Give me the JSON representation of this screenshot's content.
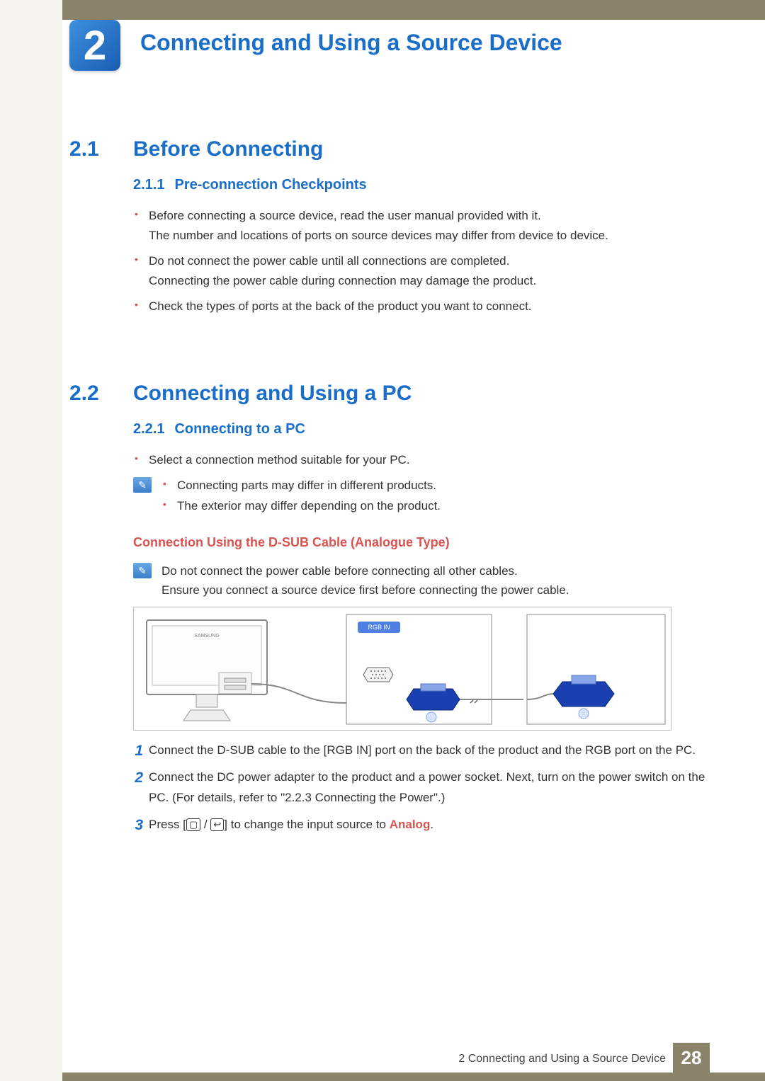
{
  "chapter": {
    "number": "2",
    "title": "Connecting and Using a Source Device"
  },
  "sections": {
    "s21": {
      "num": "2.1",
      "title": "Before Connecting"
    },
    "s211": {
      "num": "2.1.1",
      "title": "Pre-connection Checkpoints"
    },
    "s22": {
      "num": "2.2",
      "title": "Connecting and Using a PC"
    },
    "s221": {
      "num": "2.2.1",
      "title": "Connecting to a PC"
    }
  },
  "bullets211": [
    "Before connecting a source device, read the user manual provided with it.\nThe number and locations of ports on source devices may differ from device to device.",
    "Do not connect the power cable until all connections are completed.\nConnecting the power cable during connection may damage the product.",
    "Check the types of ports at the back of the product you want to connect."
  ],
  "bullets221": [
    "Select a connection method suitable for your PC."
  ],
  "note221": [
    "Connecting parts may differ in different products.",
    "The exterior may differ depending on the product."
  ],
  "h3_dsub": "Connection Using the D-SUB Cable (Analogue Type)",
  "note_dsub": "Do not connect the power cable before connecting all other cables.\nEnsure you connect a source device first before connecting the power cable.",
  "diagram": {
    "port_label": "RGB IN"
  },
  "steps": {
    "s1": "Connect the D-SUB cable to the [RGB IN] port on the back of the product and the RGB port on the PC.",
    "s2": "Connect the DC power adapter to the product and a power socket. Next, turn on the power switch on the PC. (For details, refer to \"2.2.3    Connecting the Power\".)",
    "s3_pre": "Press [",
    "s3_mid": "] to change the input source to ",
    "s3_analog": "Analog",
    "s3_post": "."
  },
  "footer": {
    "text": "2 Connecting and Using a Source Device",
    "page": "28"
  }
}
